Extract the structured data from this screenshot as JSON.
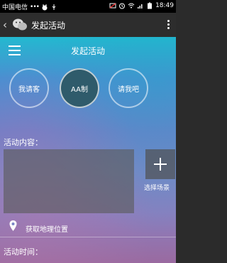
{
  "status_bar": {
    "carrier": "中国电信",
    "dots": "•••",
    "time": "18:49"
  },
  "title_bar": {
    "title": "发起活动"
  },
  "app_bar": {
    "title": "发起活动"
  },
  "options": [
    {
      "label": "我请客",
      "selected": false
    },
    {
      "label": "AA制",
      "selected": true
    },
    {
      "label": "请我吧",
      "selected": false
    }
  ],
  "activity_content": {
    "label": "活动内容：",
    "add_scene_label": "选择场景"
  },
  "location": {
    "label": "获取地理位置"
  },
  "activity_time": {
    "label": "活动时间："
  }
}
